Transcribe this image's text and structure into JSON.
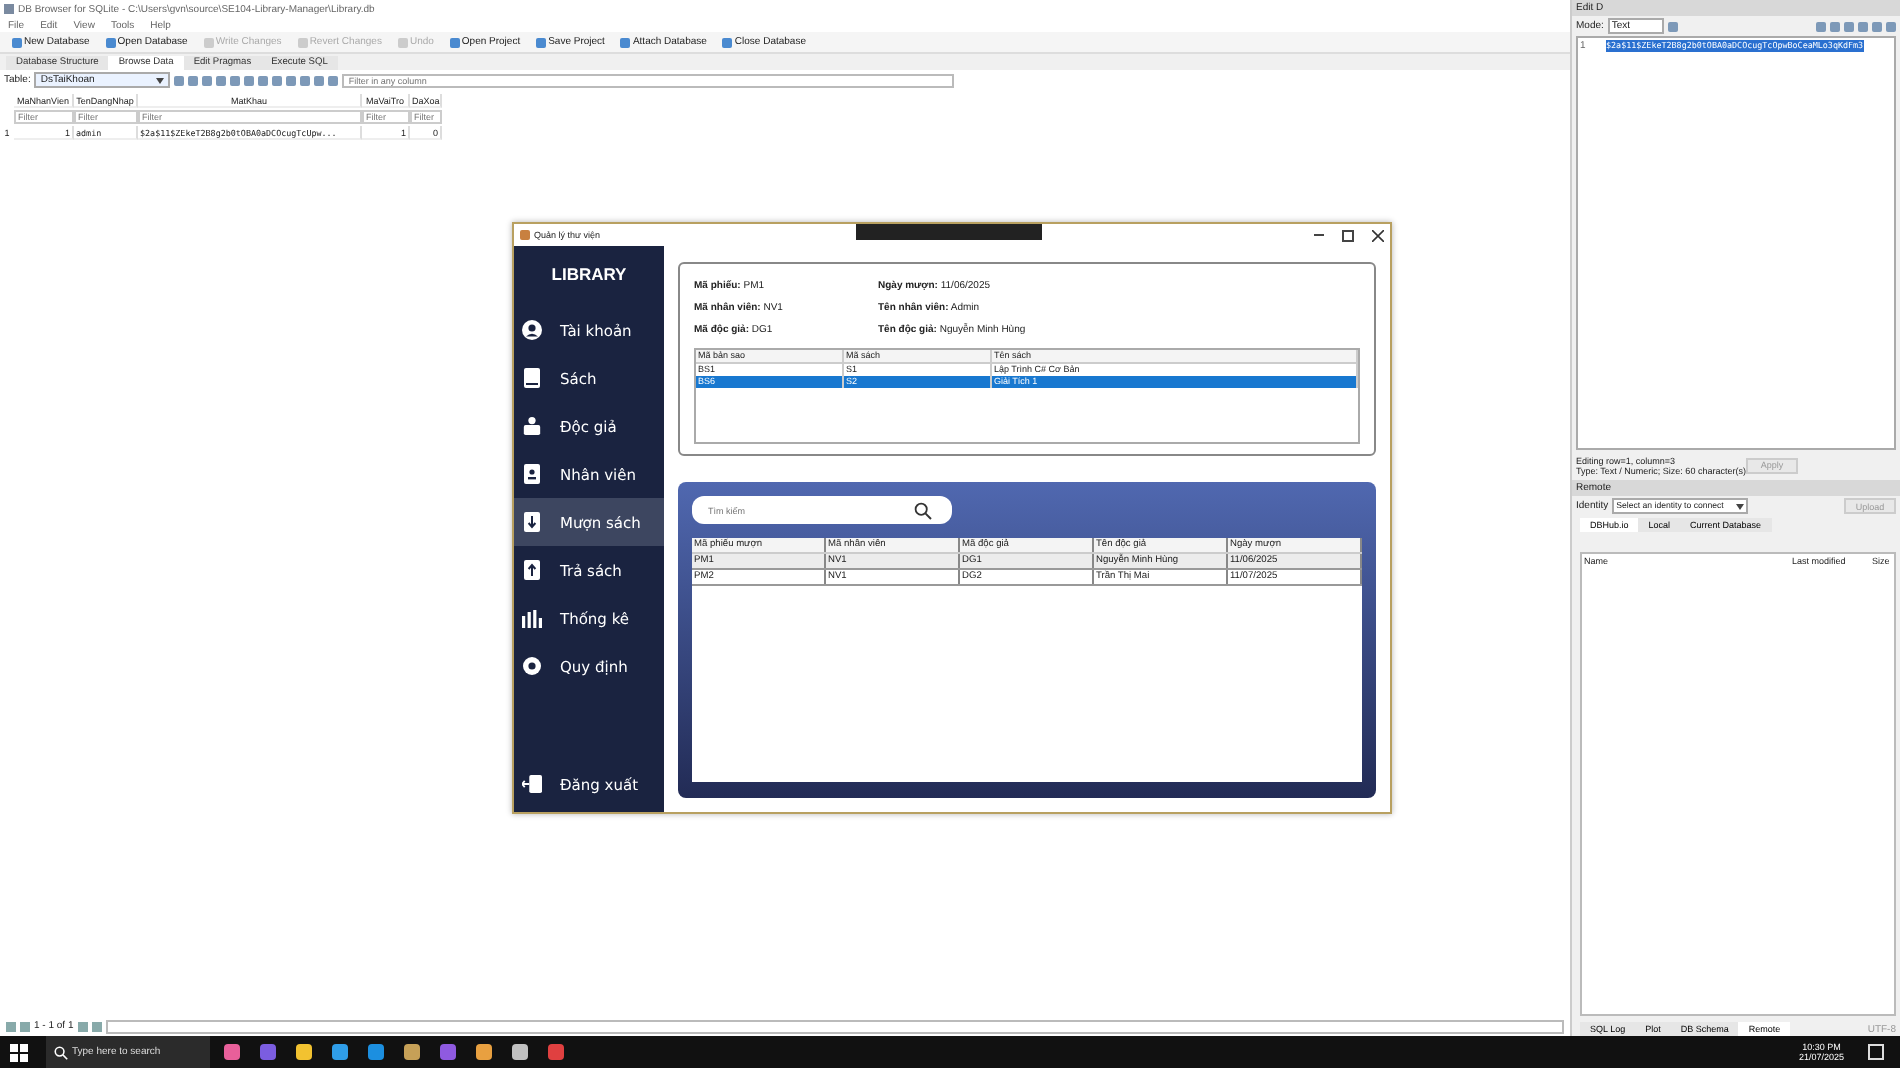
{
  "app": {
    "title": "DB Browser for SQLite - C:\\Users\\gvn\\source\\SE104-Library-Manager\\Library.db",
    "menu": [
      "File",
      "Edit",
      "View",
      "Tools",
      "Help"
    ],
    "toolbar": [
      {
        "label": "New Database",
        "disabled": false
      },
      {
        "label": "Open Database",
        "disabled": false
      },
      {
        "label": "Write Changes",
        "disabled": true
      },
      {
        "label": "Revert Changes",
        "disabled": true
      },
      {
        "label": "Undo",
        "disabled": true
      },
      {
        "label": "Open Project",
        "disabled": false
      },
      {
        "label": "Save Project",
        "disabled": false
      },
      {
        "label": "Attach Database",
        "disabled": false
      },
      {
        "label": "Close Database",
        "disabled": false
      }
    ],
    "tabs": [
      {
        "label": "Database Structure",
        "selected": false
      },
      {
        "label": "Browse Data",
        "selected": true
      },
      {
        "label": "Edit Pragmas",
        "selected": false
      },
      {
        "label": "Execute SQL",
        "selected": false
      }
    ],
    "table_label": "Table:",
    "table_select": "DsTaiKhoan",
    "filter_placeholder": "Filter in any column",
    "grid": {
      "columns": [
        "MaNhanVien",
        "TenDangNhap",
        "MatKhau",
        "MaVaiTro",
        "DaXoa"
      ],
      "filter_placeholders": [
        "Filter",
        "Filter",
        "Filter",
        "Filter",
        "Filter"
      ],
      "rows": [
        {
          "num": "1",
          "cells": [
            "1",
            "admin",
            "$2a$11$ZEkeT2B8g2b0tOBA0aDCOcugTcUpw...",
            "1",
            "0"
          ]
        }
      ]
    },
    "pager": "1 - 1 of 1"
  },
  "edit_panel": {
    "title": "Edit D",
    "mode_label": "Mode:",
    "mode": "Text",
    "line_number": "1",
    "content": "$2a$11$ZEkeT2B8g2b0tOBA0aDCOcugTcOpwBoCeaMLo3qKdFm3",
    "status": [
      "Editing row=1, column=3",
      "Type: Text / Numeric; Size: 60 character(s)"
    ],
    "apply": "Apply"
  },
  "remote_panel": {
    "title": "Remote",
    "identity_label": "Identity",
    "identity": "Select an identity to connect",
    "upload": "Upload",
    "tabs": [
      {
        "label": "DBHub.io",
        "selected": true
      },
      {
        "label": "Local",
        "selected": false
      },
      {
        "label": "Current Database",
        "selected": false
      }
    ],
    "columns": [
      "Name",
      "Last modified",
      "Size"
    ]
  },
  "bottom_tabs": [
    {
      "label": "SQL Log",
      "selected": false
    },
    {
      "label": "Plot",
      "selected": false
    },
    {
      "label": "DB Schema",
      "selected": false
    },
    {
      "label": "Remote",
      "selected": true
    }
  ],
  "encoding": "UTF-8",
  "library_window": {
    "title": "Quản lý thư viện",
    "brand": "LIBRARY",
    "nav": [
      {
        "label": "Tài khoản",
        "kind": "user",
        "selected": false
      },
      {
        "label": "Sách",
        "kind": "book",
        "selected": false
      },
      {
        "label": "Độc giả",
        "kind": "reader",
        "selected": false
      },
      {
        "label": "Nhân viên",
        "kind": "badge",
        "selected": false
      },
      {
        "label": "Mượn sách",
        "kind": "down",
        "selected": true
      },
      {
        "label": "Trả sách",
        "kind": "up",
        "selected": false
      },
      {
        "label": "Thống kê",
        "kind": "chart",
        "selected": false
      },
      {
        "label": "Quy định",
        "kind": "gear",
        "selected": false
      }
    ],
    "logout": "Đăng xuất",
    "fields": [
      {
        "label": "Mã phiếu:",
        "value": "PM1"
      },
      {
        "label": "Ngày mượn:",
        "value": "11/06/2025"
      },
      {
        "label": "Mã nhân viên:",
        "value": "NV1"
      },
      {
        "label": "Tên nhân viên:",
        "value": "Admin"
      },
      {
        "label": "Mã độc giả:",
        "value": "DG1"
      },
      {
        "label": "Tên độc giả:",
        "value": "Nguyễn Minh Hùng"
      }
    ],
    "copies": {
      "columns": [
        "Mã bản sao",
        "Mã sách",
        "Tên sách"
      ],
      "rows": [
        {
          "cells": [
            "BS1",
            "S1",
            "Lập Trình C# Cơ Bản"
          ],
          "selected": false
        },
        {
          "cells": [
            "BS6",
            "S2",
            "Giải Tích 1"
          ],
          "selected": true
        }
      ]
    },
    "search_placeholder": "Tìm kiếm",
    "loans": {
      "columns": [
        "Mã phiếu mượn",
        "Mã nhân viên",
        "Mã độc giả",
        "Tên độc giả",
        "Ngày mượn"
      ],
      "rows": [
        {
          "cells": [
            "PM1",
            "NV1",
            "DG1",
            "Nguyễn Minh Hùng",
            "11/06/2025"
          ]
        },
        {
          "cells": [
            "PM2",
            "NV1",
            "DG2",
            "Trần Thị Mai",
            "11/07/2025"
          ]
        }
      ]
    }
  },
  "taskbar": {
    "search_placeholder": "Type here to search",
    "time": "10:30 PM",
    "date": "21/07/2025"
  }
}
